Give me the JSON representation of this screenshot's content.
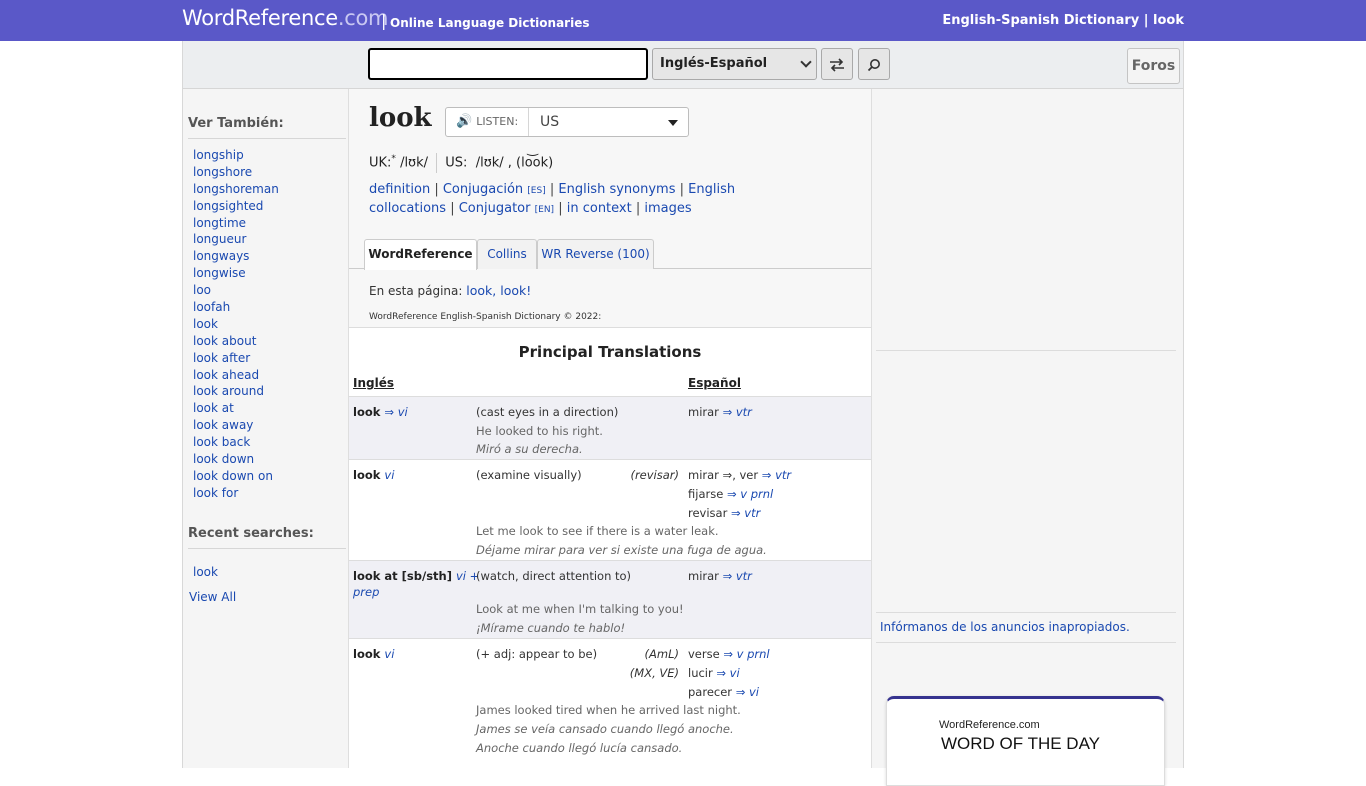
{
  "topbar": {
    "logo_main": "WordReference",
    "logo_dotcom": ".com",
    "separator": "|",
    "tagline": "Online Language Dictionaries",
    "right_title": "English-Spanish Dictionary | look"
  },
  "search": {
    "value": "",
    "dictionary": "Inglés-Español",
    "swap_icon": "swap-arrows-icon",
    "search_icon": "magnifier-icon",
    "forums_label": "Foros"
  },
  "sidebar": {
    "see_also_heading": "Ver También:",
    "see_also": [
      "longship",
      "longshore",
      "longshoreman",
      "longsighted",
      "longtime",
      "longueur",
      "longways",
      "longwise",
      "loo",
      "loofah",
      "look",
      "look about",
      "look after",
      "look ahead",
      "look around",
      "look at",
      "look away",
      "look back",
      "look down",
      "look down on",
      "look for"
    ],
    "recent_heading": "Recent searches:",
    "recent": [
      "look"
    ],
    "view_all": "View All"
  },
  "entry": {
    "headword": "look",
    "listen_label": "LISTEN:",
    "accent": "US",
    "uk_label": "UK:",
    "uk_star": "*",
    "uk_ipa": "/lʊk/",
    "us_label": "US:",
    "us_ipa": "/lʊk/ ,",
    "us_resp": "(lo͝ok)",
    "links": {
      "definition": "definition",
      "conjugacion": "Conjugación",
      "es_tag": "[ES]",
      "synonyms": "English synonyms",
      "collocations": "English collocations",
      "conjugator": "Conjugator",
      "en_tag": "[EN]",
      "in_context": "in context",
      "images": "images"
    },
    "tabs": [
      "WordReference",
      "Collins",
      "WR Reverse (100)"
    ],
    "on_page_label": "En esta página:",
    "on_page_links": "look, look!",
    "copyright": "WordReference English-Spanish Dictionary © 2022:"
  },
  "table": {
    "title": "Principal Translations",
    "col_from": "Inglés",
    "col_to": "Español",
    "rows": [
      {
        "from": "look",
        "from_pos": "⇒ vi",
        "def": "(cast eyes in a direction)",
        "to": [
          "mirar"
        ],
        "to_pos": [
          "⇒ vtr"
        ],
        "ex_en": "He looked to his right.",
        "ex_es": [
          "Miró a su derecha."
        ]
      },
      {
        "from": "look",
        "from_pos": "vi",
        "def": "(examine visually)",
        "reg": [
          "(revisar)"
        ],
        "to": [
          "mirar ⇒, ver",
          "fijarse",
          "revisar"
        ],
        "to_pos": [
          "⇒ vtr",
          "⇒ v prnl",
          "⇒ vtr"
        ],
        "ex_en": "Let me look to see if there is a water leak.",
        "ex_es": [
          "Déjame mirar para ver si existe una fuga de agua."
        ]
      },
      {
        "from": "look at [sb/sth]",
        "from_pos": "vi +",
        "from_pos2": "prep",
        "def": "(watch, direct attention to)",
        "to": [
          "mirar"
        ],
        "to_pos": [
          "⇒ vtr"
        ],
        "ex_en": "Look at me when I'm talking to you!",
        "ex_es": [
          "¡Mírame cuando te hablo!"
        ]
      },
      {
        "from": "look",
        "from_pos": "vi",
        "def": "(+ adj: appear to be)",
        "reg": [
          "(AmL)",
          "(MX, VE)"
        ],
        "to": [
          "verse",
          "lucir",
          "parecer"
        ],
        "to_pos": [
          "⇒ v prnl",
          "⇒ vi",
          "⇒ vi"
        ],
        "ex_en": "James looked tired when he arrived last night.",
        "ex_es": [
          "James se veía cansado cuando llegó anoche.",
          "Anoche cuando llegó lucía cansado."
        ]
      }
    ]
  },
  "right": {
    "report_ads": "Infórmanos de los anuncios inapropiados.",
    "wotd_site": "WordReference.com",
    "wotd_title": "WORD OF THE DAY"
  },
  "colors": {
    "brand": "#5a58c8",
    "link": "#1a49b0"
  }
}
